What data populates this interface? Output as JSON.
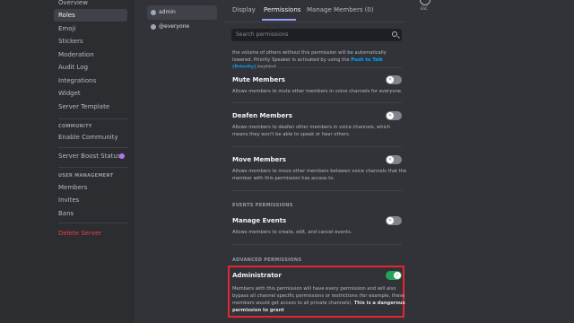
{
  "sidebar": {
    "items_top": [
      "Overview",
      "Roles",
      "Emoji",
      "Stickers",
      "Moderation",
      "Audit Log",
      "Integrations",
      "Widget",
      "Server Template"
    ],
    "community_header": "COMMUNITY",
    "enable_community": "Enable Community",
    "server_boost": "Server Boost Status",
    "user_mgmt_header": "USER MANAGEMENT",
    "user_items": [
      "Members",
      "Invites",
      "Bans"
    ],
    "delete_server": "Delete Server"
  },
  "roles": [
    {
      "name": "admin"
    },
    {
      "name": "@everyone"
    }
  ],
  "tabs": {
    "display": "Display",
    "permissions": "Permissions",
    "manage_members": "Manage Members (0)"
  },
  "esc_label": "ESC",
  "search": {
    "placeholder": "Search permissions"
  },
  "priority_text": {
    "part1": "the volume of others without this permission will be automatically lowered. Priority Speaker is activated by using the ",
    "link": "Push to Talk (Priority)",
    "part2": " keybind."
  },
  "permissions": {
    "mute": {
      "title": "Mute Members",
      "desc": "Allows members to mute other members in voice channels for everyone."
    },
    "deafen": {
      "title": "Deafen Members",
      "desc": "Allows members to deafen other members in voice channels, which means they won't be able to speak or hear others."
    },
    "move": {
      "title": "Move Members",
      "desc": "Allows members to move other members between voice channels that the member with this permission has access to."
    },
    "events_header": "EVENTS PERMISSIONS",
    "manage_events": {
      "title": "Manage Events",
      "desc": "Allows members to create, edit, and cancel events."
    },
    "advanced_header": "ADVANCED PERMISSIONS",
    "admin": {
      "title": "Administrator",
      "desc": "Members with this permission will have every permission and will also bypass all channel specific permissions or restrictions (for example, these members would get access to all private channels). ",
      "desc_bold": "This is a dangerous permission to grant"
    }
  },
  "colors": {
    "accent": "#949cf7",
    "toggle_on": "#23a559",
    "danger": "#f23f43",
    "highlight": "#e5262e"
  }
}
